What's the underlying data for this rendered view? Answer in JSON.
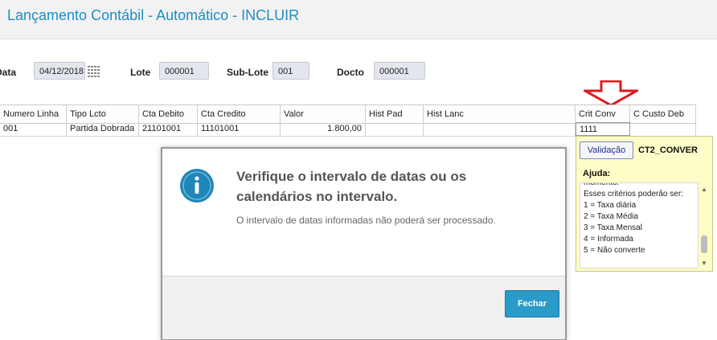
{
  "window": {
    "title": "Lançamento Contábil - Automático - INCLUIR"
  },
  "header_fields": {
    "data_label": "Data",
    "data_value": "04/12/2018",
    "lote_label": "Lote",
    "lote_value": "000001",
    "sublote_label": "Sub-Lote",
    "sublote_value": "001",
    "docto_label": "Docto",
    "docto_value": "000001"
  },
  "grid": {
    "columns": [
      "Numero Linha",
      "Tipo Lcto",
      "Cta Debito",
      "Cta Credito",
      "Valor",
      "Hist Pad",
      "Hist Lanc",
      "Crit Conv",
      "C Custo Deb"
    ],
    "rows": [
      [
        "001",
        "Partida Dobrada",
        "21101001",
        "11101001",
        "1.800,00",
        "",
        "",
        "1111",
        ""
      ]
    ]
  },
  "help_panel": {
    "validate_label": "Validação",
    "field_code": "CT2_CONVER",
    "help_label": "Ajuda:",
    "lines": [
      "momento.",
      "Esses critérios poderão ser:",
      "1 = Taxa diária",
      "2 = Taxa Média",
      "3 = Taxa Mensal",
      "4 = Informada",
      "5 = Não converte"
    ]
  },
  "modal": {
    "title": "Verifique o intervalo de datas ou os calendários no intervalo.",
    "message": "O intervalo de datas informadas não poderá ser processado.",
    "close_label": "Fechar"
  },
  "colors": {
    "title_blue": "#1b8fc4",
    "arrow_red": "#e0191c",
    "help_bg": "#fffdc7",
    "info_icon": "#1f86b8",
    "button_blue": "#2a9ac9"
  }
}
